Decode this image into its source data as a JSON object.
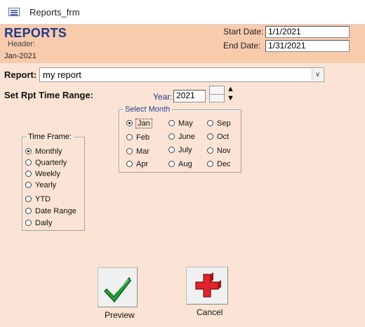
{
  "window": {
    "title": "Reports_frm",
    "icon": "form-icon"
  },
  "header": {
    "title": "REPORTS",
    "subtitle": "Header:",
    "period": "Jan-2021",
    "start_date_label": "Start Date:",
    "start_date": "1/1/2021",
    "end_date_label": "End Date:",
    "end_date": "1/31/2021",
    "band_color": "#f8cbad"
  },
  "report": {
    "label": "Report:",
    "value": "my report",
    "dropdown_icon": "chevron-down-icon"
  },
  "range": {
    "label": "Set Rpt Time Range:",
    "year_label": "Year:",
    "year_value": "2021",
    "year_up": "▲",
    "year_down": "▼"
  },
  "month_group": {
    "legend": "Select Month",
    "selected": "Jan",
    "months": [
      "Jan",
      "Feb",
      "Mar",
      "Apr",
      "May",
      "June",
      "July",
      "Aug",
      "Sep",
      "Oct",
      "Nov",
      "Dec"
    ]
  },
  "time_frame": {
    "legend": "Time Frame:",
    "selected": "Monthly",
    "options": [
      "Monthly",
      "Quarterly",
      "Weekly",
      "Yearly",
      "YTD",
      "Date Range",
      "Daily"
    ]
  },
  "buttons": {
    "preview": {
      "label": "Preview",
      "icon": "checkmark-icon"
    },
    "cancel": {
      "label": "Cancel",
      "icon": "red-cross-icon"
    }
  },
  "colors": {
    "background": "#fbe4d5",
    "accent": "#1f3a8a"
  }
}
